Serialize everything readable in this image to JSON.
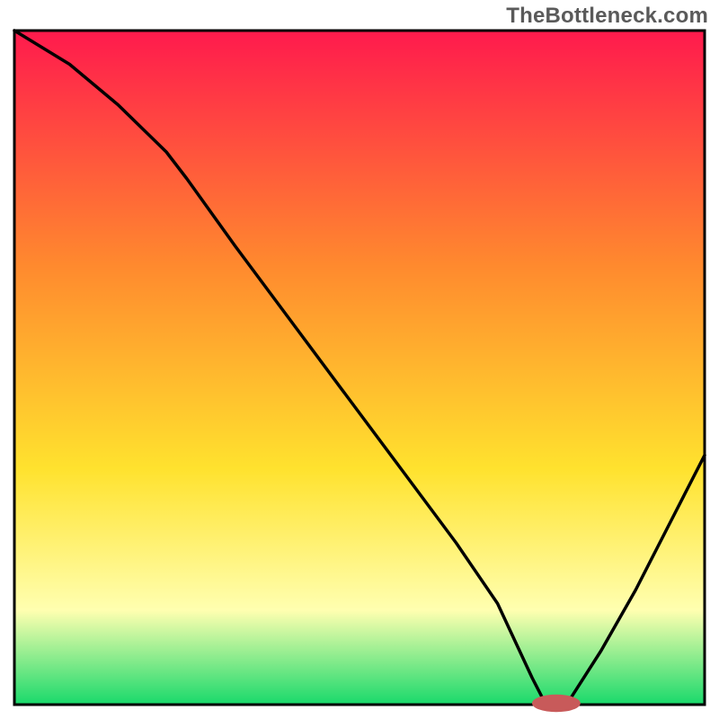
{
  "watermark": {
    "text": "TheBottleneck.com"
  },
  "colors": {
    "gradient_top": "#ff1a4d",
    "gradient_mid1": "#ff8a2e",
    "gradient_mid2": "#ffe22e",
    "gradient_mid3": "#ffffb0",
    "gradient_bottom": "#19d96b",
    "curve_stroke": "#000000",
    "marker_fill": "#c85a5a",
    "frame_stroke": "#000000"
  },
  "chart_data": {
    "type": "line",
    "title": "",
    "xlabel": "",
    "ylabel": "",
    "xlim": [
      0,
      100
    ],
    "ylim": [
      0,
      100
    ],
    "grid": false,
    "legend": false,
    "description": "V-shaped bottleneck curve over a red-to-green vertical heat gradient. The curve descends from top-left, kinks near x≈25, continues almost linearly to a minimum near x≈77–80 (y≈0), then rises toward the right edge. A small pink marker sits at the trough.",
    "series": [
      {
        "name": "bottleneck-curve",
        "x": [
          0,
          8,
          15,
          22,
          25,
          32,
          40,
          48,
          56,
          64,
          70,
          75,
          77,
          80,
          85,
          90,
          95,
          100
        ],
        "y": [
          100,
          95,
          89,
          82,
          78,
          68,
          57,
          46,
          35,
          24,
          15,
          4,
          0,
          0,
          8,
          17,
          27,
          37
        ]
      }
    ],
    "marker": {
      "x": 78.5,
      "y": 0.2,
      "rx": 3.5,
      "ry": 1.3
    },
    "axes_visible": false,
    "frame_visible": true
  }
}
